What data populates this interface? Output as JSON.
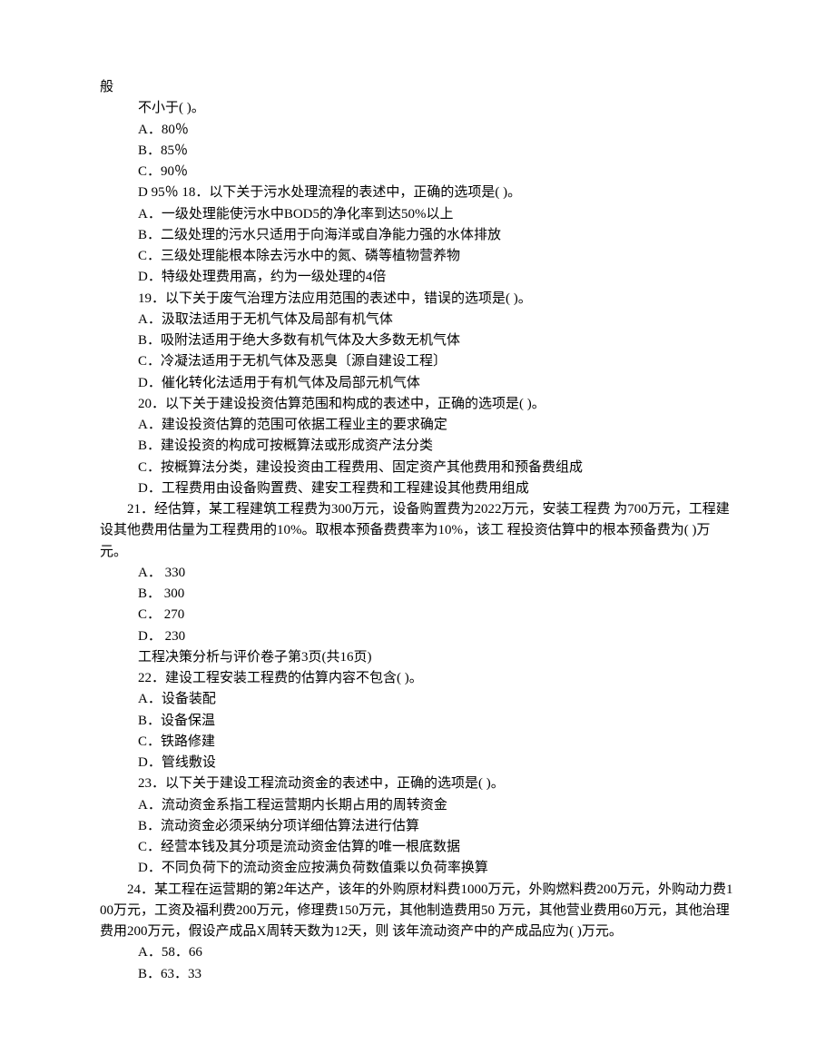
{
  "lines": [
    {
      "cls": "hang",
      "text": "般"
    },
    {
      "cls": "indent1",
      "text": "不小于( )。"
    },
    {
      "cls": "indent1",
      "text": "A．80％"
    },
    {
      "cls": "indent1",
      "text": "B．85％"
    },
    {
      "cls": "indent1",
      "text": "C．90％"
    },
    {
      "cls": "indent1",
      "text": "D 95％ 18．以下关于污水处理流程的表述中，正确的选项是( )。"
    },
    {
      "cls": "indent1",
      "text": "A．一级处理能使污水中BOD5的净化率到达50%以上"
    },
    {
      "cls": "indent1",
      "text": "B．二级处理的污水只适用于向海洋或自净能力强的水体排放"
    },
    {
      "cls": "indent1",
      "text": "C．三级处理能根本除去污水中的氮、磷等植物营养物"
    },
    {
      "cls": "indent1",
      "text": "D．特级处理费用高，约为一级处理的4倍"
    },
    {
      "cls": "indent1",
      "text": "19．以下关于废气治理方法应用范围的表述中，错误的选项是( )。"
    },
    {
      "cls": "indent1",
      "text": "A．汲取法适用于无机气体及局部有机气体"
    },
    {
      "cls": "indent1",
      "text": "B．吸附法适用于绝大多数有机气体及大多数无机气体"
    },
    {
      "cls": "indent1",
      "text": "C．冷凝法适用于无机气体及恶臭〔源自建设工程〕"
    },
    {
      "cls": "indent1",
      "text": "D．催化转化法适用于有机气体及局部元机气体"
    },
    {
      "cls": "indent1",
      "text": "20．以下关于建设投资估算范围和构成的表述中，正确的选项是( )。"
    },
    {
      "cls": "indent1",
      "text": "A．建设投资估算的范围可依据工程业主的要求确定"
    },
    {
      "cls": "indent1",
      "text": "B．建设投资的构成可按概算法或形成资产法分类"
    },
    {
      "cls": "indent1",
      "text": "C．按概算法分类，建设投资由工程费用、固定资产其他费用和预备费组成"
    },
    {
      "cls": "indent1",
      "text": "D．工程费用由设备购置费、建安工程费和工程建设其他费用组成"
    },
    {
      "cls": "hang nowrap-left",
      "text": "　　21．经估算，某工程建筑工程费为300万元，设备购置费为2022万元，安装工程费 为700万元，工程建设其他费用估量为工程费用的10%。取根本预备费费率为10%，该工 程投资估算中的根本预备费为( )万元。"
    },
    {
      "cls": "indent1",
      "text": "A． 330"
    },
    {
      "cls": "indent1",
      "text": "B． 300"
    },
    {
      "cls": "indent1",
      "text": "C． 270"
    },
    {
      "cls": "indent1",
      "text": "D． 230"
    },
    {
      "cls": "indent1",
      "text": "工程决策分析与评价卷子第3页(共16页)"
    },
    {
      "cls": "indent1",
      "text": "22．建设工程安装工程费的估算内容不包含( )。"
    },
    {
      "cls": "indent1",
      "text": "A．设备装配"
    },
    {
      "cls": "indent1",
      "text": "B．设备保温"
    },
    {
      "cls": "indent1",
      "text": "C．铁路修建"
    },
    {
      "cls": "indent1",
      "text": "D．管线敷设"
    },
    {
      "cls": "indent1",
      "text": "23．以下关于建设工程流动资金的表述中，正确的选项是( )。"
    },
    {
      "cls": "indent1",
      "text": "A．流动资金系指工程运营期内长期占用的周转资金"
    },
    {
      "cls": "indent1",
      "text": "B．流动资金必须采纳分项详细估算法进行估算"
    },
    {
      "cls": "indent1",
      "text": "C．经营本钱及其分项是流动资金估算的唯一根底数据"
    },
    {
      "cls": "indent1",
      "text": "D．不同负荷下的流动资金应按满负荷数值乘以负荷率换算"
    },
    {
      "cls": "hang nowrap-left",
      "text": "　　24．某工程在运营期的第2年达产，该年的外购原材料费1000万元，外购燃料费200万元，外购动力费100万元，工资及福利费200万元，修理费150万元，其他制造费用50 万元，其他营业费用60万元，其他治理费用200万元，假设产成品X周转天数为12天，则 该年流动资产中的产成品应为( )万元。"
    },
    {
      "cls": "indent1",
      "text": "A．58．66"
    },
    {
      "cls": "indent1",
      "text": "B．63．33"
    }
  ]
}
